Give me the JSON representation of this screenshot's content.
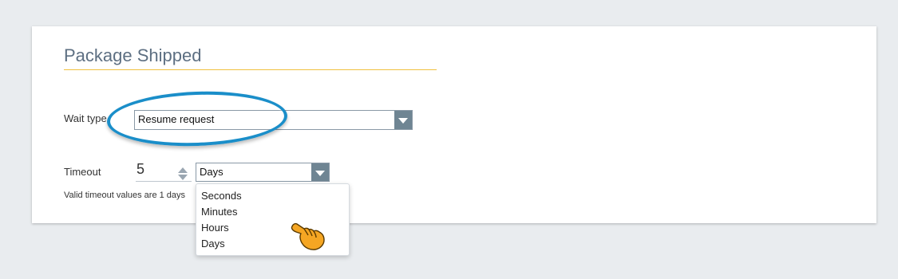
{
  "form": {
    "title": "Package Shipped",
    "wait_type": {
      "label": "Wait type",
      "selected": "Resume request"
    },
    "timeout": {
      "label": "Timeout",
      "value": "5",
      "unit_selected": "Days",
      "helper": "Valid timeout values are 1 days"
    }
  },
  "dropdown": {
    "options": [
      "Seconds",
      "Minutes",
      "Hours",
      "Days"
    ]
  },
  "colors": {
    "title": "#5d6f82",
    "title_rule": "#f0c040",
    "select_arrow": "#6f8593",
    "annotation": "#1a8ec9",
    "cursor": "#f5a623"
  },
  "icons": {
    "select_arrow": "chevron-down-icon",
    "spinner": "spinner-arrows-icon",
    "cursor": "pointing-hand-cursor-icon"
  }
}
